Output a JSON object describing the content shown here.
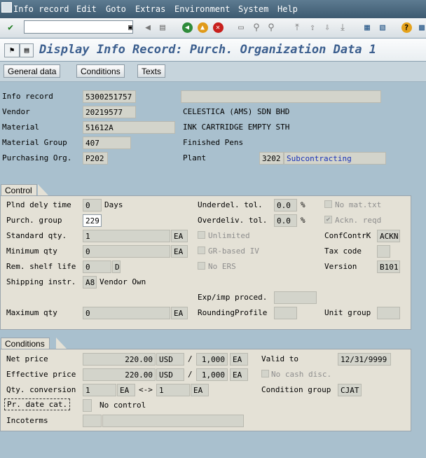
{
  "menu": [
    "Info record",
    "Edit",
    "Goto",
    "Extras",
    "Environment",
    "System",
    "Help"
  ],
  "toolbar": {
    "command_value": ""
  },
  "title": "Display Info Record: Purch. Organization Data 1",
  "app_buttons": [
    "General data",
    "Conditions",
    "Texts"
  ],
  "header": {
    "info_record_label": "Info record",
    "info_record": "5300251757",
    "vendor_label": "Vendor",
    "vendor": "20219577",
    "vendor_name": "CELESTICA (AMS) SDN BHD",
    "material_label": "Material",
    "material": "51612A",
    "material_desc": "INK CARTRIDGE EMPTY STH",
    "material_group_label": "Material Group",
    "material_group": "407",
    "material_group_desc": "Finished Pens",
    "purch_org_label": "Purchasing Org.",
    "purch_org": "P202",
    "plant_label": "Plant",
    "plant": "3202",
    "plant_desc": "Subcontracting"
  },
  "control": {
    "title": "Control",
    "plnd_label": "Plnd dely time",
    "plnd": "0",
    "days": "Days",
    "purch_group_label": "Purch. group",
    "purch_group": "229",
    "std_qty_label": "Standard qty.",
    "std_qty": "1",
    "std_uom": "EA",
    "min_qty_label": "Minimum qty",
    "min_qty": "0",
    "min_uom": "EA",
    "shelf_label": "Rem. shelf life",
    "shelf": "0",
    "shelf_unit": "D",
    "ship_label": "Shipping instr.",
    "ship": "A8",
    "ship_desc": "Vendor Own",
    "max_qty_label": "Maximum qty",
    "max_qty": "0",
    "max_uom": "EA",
    "underdel_label": "Underdel. tol.",
    "underdel": "0.0",
    "pct": "%",
    "overdel_label": "Overdeliv. tol.",
    "overdel": "0.0",
    "unlimited": "Unlimited",
    "gr_iv": "GR-based IV",
    "no_ers": "No ERS",
    "exp_label": "Exp/imp proced.",
    "rounding_label": "RoundingProfile",
    "no_mat": "No mat.txt",
    "ackn": "Ackn. reqd",
    "confctrl_label": "ConfContrK",
    "confctrl": "ACKN",
    "tax_label": "Tax code",
    "version_label": "Version",
    "version": "B101",
    "unit_group_label": "Unit group"
  },
  "conditions": {
    "title": "Conditions",
    "net_label": "Net price",
    "net": "220.00",
    "net_cur": "USD",
    "net_per": "1,000",
    "net_uom": "EA",
    "eff_label": "Effective price",
    "eff": "220.00",
    "eff_cur": "USD",
    "eff_per": "1,000",
    "eff_uom": "EA",
    "qty_conv_label": "Qty. conversion",
    "qc1": "1",
    "qc1_uom": "EA",
    "arrow": "<->",
    "qc2": "1",
    "qc2_uom": "EA",
    "pr_date_label": "Pr. date cat.",
    "pr_date_desc": "No control",
    "incoterms_label": "Incoterms",
    "valid_label": "Valid to",
    "valid": "12/31/9999",
    "no_cash": "No cash disc.",
    "cond_group_label": "Condition group",
    "cond_group": "CJAT"
  }
}
